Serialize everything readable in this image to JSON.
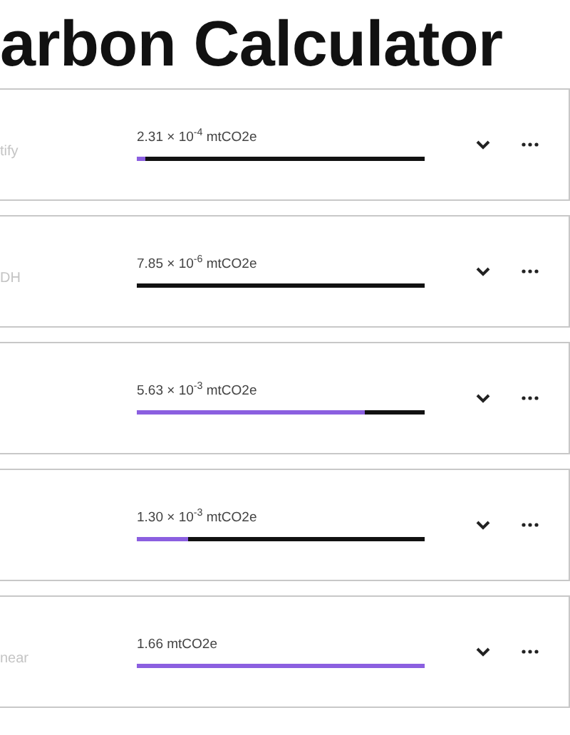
{
  "title": "arbon Calculator",
  "items": [
    {
      "label": "tify",
      "reading": "2.31 × 10$^{-4}$ mtCO2e",
      "level": 0.03
    },
    {
      "label": "DH",
      "reading": "7.85 × 10$^{-6}$ mtCO2e",
      "level": 0
    },
    {
      "reading": "5.63 × 10$^{-3}$ mtCO2e",
      "level": 0.79
    },
    {
      "reading": "1.30 × 10$^{-3}$ mtCO2e",
      "level": 0.18
    },
    {
      "label": "near",
      "reading": "1.66 mtCO2e",
      "level": 1
    }
  ]
}
